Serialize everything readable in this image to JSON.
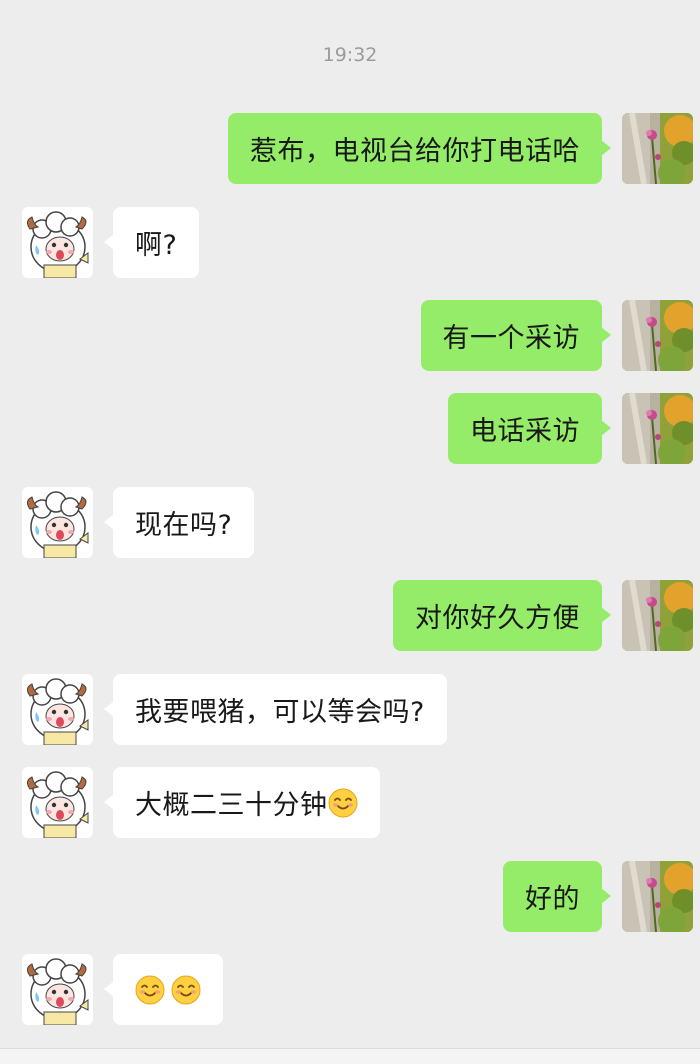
{
  "chat": {
    "timestamp": "19:32",
    "messages": [
      {
        "side": "out",
        "text": "惹布，电视台给你打电话哈"
      },
      {
        "side": "in",
        "text": "啊?"
      },
      {
        "side": "out",
        "text": "有一个采访"
      },
      {
        "side": "out",
        "text": "电话采访"
      },
      {
        "side": "in",
        "text": "现在吗?"
      },
      {
        "side": "out",
        "text": "对你好久方便"
      },
      {
        "side": "in",
        "text": "我要喂猪，可以等会吗?"
      },
      {
        "side": "in",
        "text": "大概二三十分钟",
        "emoji": [
          "smiling-face-icon"
        ]
      },
      {
        "side": "out",
        "text": "好的"
      },
      {
        "side": "in",
        "text": "",
        "emoji": [
          "smiling-face-icon",
          "smiling-face-icon"
        ]
      }
    ]
  },
  "colors": {
    "background": "#ededed",
    "outgoing_bubble": "#95ec69",
    "incoming_bubble": "#ffffff"
  },
  "icons": {
    "self_avatar": "flower-photo-avatar",
    "contact_avatar": "cartoon-sheep-avatar",
    "emoji": "smiling-face-icon"
  }
}
